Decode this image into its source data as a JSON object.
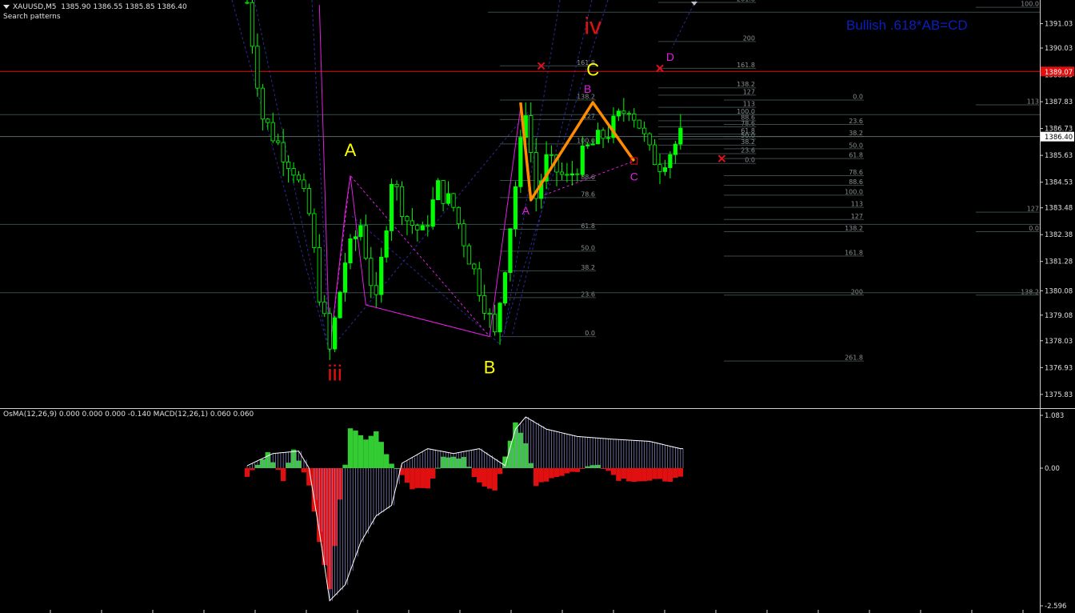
{
  "header": {
    "symbol": "XAUUSD,M5",
    "ohlc": "1385.90 1386.55 1385.85 1386.40",
    "subtitle": "Search patterns"
  },
  "pattern_title": "Bullish .618*AB=CD",
  "indicator": {
    "title": "OsMA(12,26,9) 0.000 0.000 0.000 -0.140  MACD(12,26,1) 0.060 0.060",
    "scale_top": "1.083",
    "scale_zero": "0.00",
    "scale_bottom": "-2.596"
  },
  "colors": {
    "background": "#000000",
    "bull_candle": "#00ff00",
    "wave_label_red": "#e01010",
    "wave_label_yellow": "#ffff00",
    "pattern_magenta": "#e020e0",
    "abcd_orange": "#ff8c00",
    "osma_up": "#33cc33",
    "osma_down": "#e01010",
    "macd_line": "#ffffff",
    "price_tag": "#e01010"
  },
  "chart_data": {
    "type": "candlestick",
    "title": "XAUUSD,M5",
    "ylim": [
      1375.3,
      1392.0
    ],
    "price_axis_labels": [
      "1391.03",
      "1390.03",
      "1388.93",
      "1387.83",
      "1386.73",
      "1385.63",
      "1384.53",
      "1383.48",
      "1382.38",
      "1381.28",
      "1380.08",
      "1379.08",
      "1378.03",
      "1376.93",
      "1375.83"
    ],
    "current_price": "1386.40",
    "red_line_price": "1389.07",
    "price_path": [
      {
        "bar": 0,
        "price": 1391.9
      },
      {
        "bar": 3,
        "price": 1387.2
      },
      {
        "bar": 6,
        "price": 1386.1
      },
      {
        "bar": 9,
        "price": 1385.1
      },
      {
        "bar": 12,
        "price": 1383.2
      },
      {
        "bar": 14,
        "price": 1380.0
      },
      {
        "bar": 16,
        "price": 1377.6
      },
      {
        "bar": 19,
        "price": 1381.3
      },
      {
        "bar": 22,
        "price": 1382.8
      },
      {
        "bar": 24,
        "price": 1380.5
      },
      {
        "bar": 25,
        "price": 1379.5
      },
      {
        "bar": 28,
        "price": 1384.7
      },
      {
        "bar": 31,
        "price": 1383.0
      },
      {
        "bar": 34,
        "price": 1382.4
      },
      {
        "bar": 37,
        "price": 1384.3
      },
      {
        "bar": 40,
        "price": 1383.5
      },
      {
        "bar": 43,
        "price": 1381.5
      },
      {
        "bar": 46,
        "price": 1379.6
      },
      {
        "bar": 48,
        "price": 1378.2
      },
      {
        "bar": 50,
        "price": 1381.2
      },
      {
        "bar": 52,
        "price": 1384.4
      },
      {
        "bar": 54,
        "price": 1387.6
      },
      {
        "bar": 56,
        "price": 1383.9
      },
      {
        "bar": 58,
        "price": 1385.4
      },
      {
        "bar": 62,
        "price": 1384.6
      },
      {
        "bar": 66,
        "price": 1385.9
      },
      {
        "bar": 70,
        "price": 1386.6
      },
      {
        "bar": 74,
        "price": 1387.7
      },
      {
        "bar": 76,
        "price": 1386.9
      },
      {
        "bar": 78,
        "price": 1385.7
      },
      {
        "bar": 80,
        "price": 1385.3
      },
      {
        "bar": 82,
        "price": 1385.8
      },
      {
        "bar": 84,
        "price": 1386.4
      }
    ],
    "wave_labels": [
      {
        "text": "iii",
        "bar": 17,
        "price": 1376.4,
        "color": "#e01010",
        "size": 28
      },
      {
        "text": "iv",
        "bar": 67,
        "price": 1390.6,
        "color": "#e01010",
        "size": 30
      },
      {
        "text": "A",
        "bar": 20,
        "price": 1385.6,
        "color": "#ffff00",
        "size": 22
      },
      {
        "text": "B",
        "bar": 47,
        "price": 1376.7,
        "color": "#ffff00",
        "size": 22
      },
      {
        "text": "C",
        "bar": 67,
        "price": 1388.9,
        "color": "#ffff00",
        "size": 22
      },
      {
        "text": "A",
        "bar": 54,
        "price": 1383.2,
        "color": "#e020e0",
        "size": 14
      },
      {
        "text": "B",
        "bar": 66,
        "price": 1388.2,
        "color": "#e020e0",
        "size": 14
      },
      {
        "text": "C",
        "bar": 75,
        "price": 1384.6,
        "color": "#e020e0",
        "size": 14
      },
      {
        "text": "D",
        "bar": 82,
        "price": 1389.5,
        "color": "#e020e0",
        "size": 14
      }
    ],
    "abcd_pattern": [
      {
        "bar": 53,
        "price": 1387.8
      },
      {
        "bar": 55,
        "price": 1383.8
      },
      {
        "bar": 67,
        "price": 1387.8
      },
      {
        "bar": 75,
        "price": 1385.4
      }
    ],
    "fib_left": [
      {
        "text": "161.8",
        "price": 1389.3
      },
      {
        "text": "138.2",
        "price": 1387.9
      },
      {
        "text": "127",
        "price": 1387.1
      },
      {
        "text": "100.0",
        "price": 1386.1
      },
      {
        "text": "88.6",
        "price": 1384.6
      },
      {
        "text": "78.6",
        "price": 1383.9
      },
      {
        "text": "61.8",
        "price": 1382.6
      },
      {
        "text": "50.0",
        "price": 1381.7
      },
      {
        "text": "38.2",
        "price": 1380.9
      },
      {
        "text": "23.6",
        "price": 1379.8
      },
      {
        "text": "0.0",
        "price": 1378.2
      }
    ],
    "fib_mid": [
      {
        "text": "261.8",
        "price": 1391.9
      },
      {
        "text": "200",
        "price": 1390.3
      },
      {
        "text": "161.8",
        "price": 1389.2
      },
      {
        "text": "138.2",
        "price": 1388.4
      },
      {
        "text": "127",
        "price": 1388.1
      },
      {
        "text": "113",
        "price": 1387.6
      },
      {
        "text": "100.0",
        "price": 1387.3
      },
      {
        "text": "88.6",
        "price": 1387.05
      },
      {
        "text": "78.6",
        "price": 1386.8
      },
      {
        "text": "61.8",
        "price": 1386.5
      },
      {
        "text": "50.0",
        "price": 1386.3
      },
      {
        "text": "38.2",
        "price": 1386.05
      },
      {
        "text": "23.6",
        "price": 1385.7
      },
      {
        "text": "0.0",
        "price": 1385.3
      }
    ],
    "fib_right": [
      {
        "text": "0.0",
        "price": 1387.9
      },
      {
        "text": "23.6",
        "price": 1386.9
      },
      {
        "text": "38.2",
        "price": 1386.4
      },
      {
        "text": "50.0",
        "price": 1385.9
      },
      {
        "text": "61.8",
        "price": 1385.5
      },
      {
        "text": "78.6",
        "price": 1384.8
      },
      {
        "text": "88.6",
        "price": 1384.4
      },
      {
        "text": "100.0",
        "price": 1384.0
      },
      {
        "text": "113",
        "price": 1383.5
      },
      {
        "text": "127",
        "price": 1383.0
      },
      {
        "text": "138.2",
        "price": 1382.5
      },
      {
        "text": "161.8",
        "price": 1381.5
      },
      {
        "text": "200",
        "price": 1379.9
      },
      {
        "text": "261.8",
        "price": 1377.2
      }
    ],
    "fib_far": [
      {
        "text": "100.0",
        "price": 1391.7
      },
      {
        "text": "113",
        "price": 1387.7
      },
      {
        "text": "127",
        "price": 1383.3
      },
      {
        "text": "0.0",
        "price": 1382.5
      },
      {
        "text": "138.2",
        "price": 1379.9
      }
    ],
    "x_markers": [
      {
        "bar": 57,
        "price": 1389.3
      },
      {
        "bar": 80,
        "price": 1389.2
      },
      {
        "bar": 92,
        "price": 1385.5
      }
    ],
    "macd_path": [
      {
        "bar": 0,
        "value": 0.05
      },
      {
        "bar": 5,
        "value": 0.3
      },
      {
        "bar": 10,
        "value": 0.35
      },
      {
        "bar": 12,
        "value": 0.0
      },
      {
        "bar": 14,
        "value": -1.2
      },
      {
        "bar": 16,
        "value": -2.5
      },
      {
        "bar": 19,
        "value": -2.2
      },
      {
        "bar": 22,
        "value": -1.4
      },
      {
        "bar": 25,
        "value": -0.9
      },
      {
        "bar": 28,
        "value": -0.7
      },
      {
        "bar": 30,
        "value": 0.1
      },
      {
        "bar": 35,
        "value": 0.4
      },
      {
        "bar": 40,
        "value": 0.3
      },
      {
        "bar": 45,
        "value": 0.4
      },
      {
        "bar": 50,
        "value": 0.05
      },
      {
        "bar": 52,
        "value": 0.8
      },
      {
        "bar": 54,
        "value": 1.05
      },
      {
        "bar": 58,
        "value": 0.8
      },
      {
        "bar": 64,
        "value": 0.65
      },
      {
        "bar": 70,
        "value": 0.6
      },
      {
        "bar": 78,
        "value": 0.55
      },
      {
        "bar": 84,
        "value": 0.4
      }
    ],
    "osma_path": [
      {
        "bar": 0,
        "value": -0.2
      },
      {
        "bar": 4,
        "value": 0.35
      },
      {
        "bar": 7,
        "value": -0.25
      },
      {
        "bar": 9,
        "value": 0.4
      },
      {
        "bar": 12,
        "value": -0.3
      },
      {
        "bar": 14,
        "value": -1.4
      },
      {
        "bar": 16,
        "value": -2.3
      },
      {
        "bar": 18,
        "value": -0.6
      },
      {
        "bar": 20,
        "value": 0.8
      },
      {
        "bar": 23,
        "value": 0.6
      },
      {
        "bar": 25,
        "value": 0.75
      },
      {
        "bar": 28,
        "value": 0.1
      },
      {
        "bar": 32,
        "value": -0.4
      },
      {
        "bar": 35,
        "value": -0.35
      },
      {
        "bar": 38,
        "value": 0.2
      },
      {
        "bar": 42,
        "value": 0.2
      },
      {
        "bar": 45,
        "value": -0.3
      },
      {
        "bar": 48,
        "value": -0.4
      },
      {
        "bar": 52,
        "value": 0.9
      },
      {
        "bar": 54,
        "value": 0.5
      },
      {
        "bar": 56,
        "value": -0.3
      },
      {
        "bar": 60,
        "value": -0.15
      },
      {
        "bar": 64,
        "value": -0.05
      },
      {
        "bar": 68,
        "value": 0.1
      },
      {
        "bar": 72,
        "value": -0.2
      },
      {
        "bar": 78,
        "value": -0.25
      },
      {
        "bar": 84,
        "value": -0.2
      }
    ],
    "indicator_ylim": [
      -2.596,
      1.083
    ]
  }
}
